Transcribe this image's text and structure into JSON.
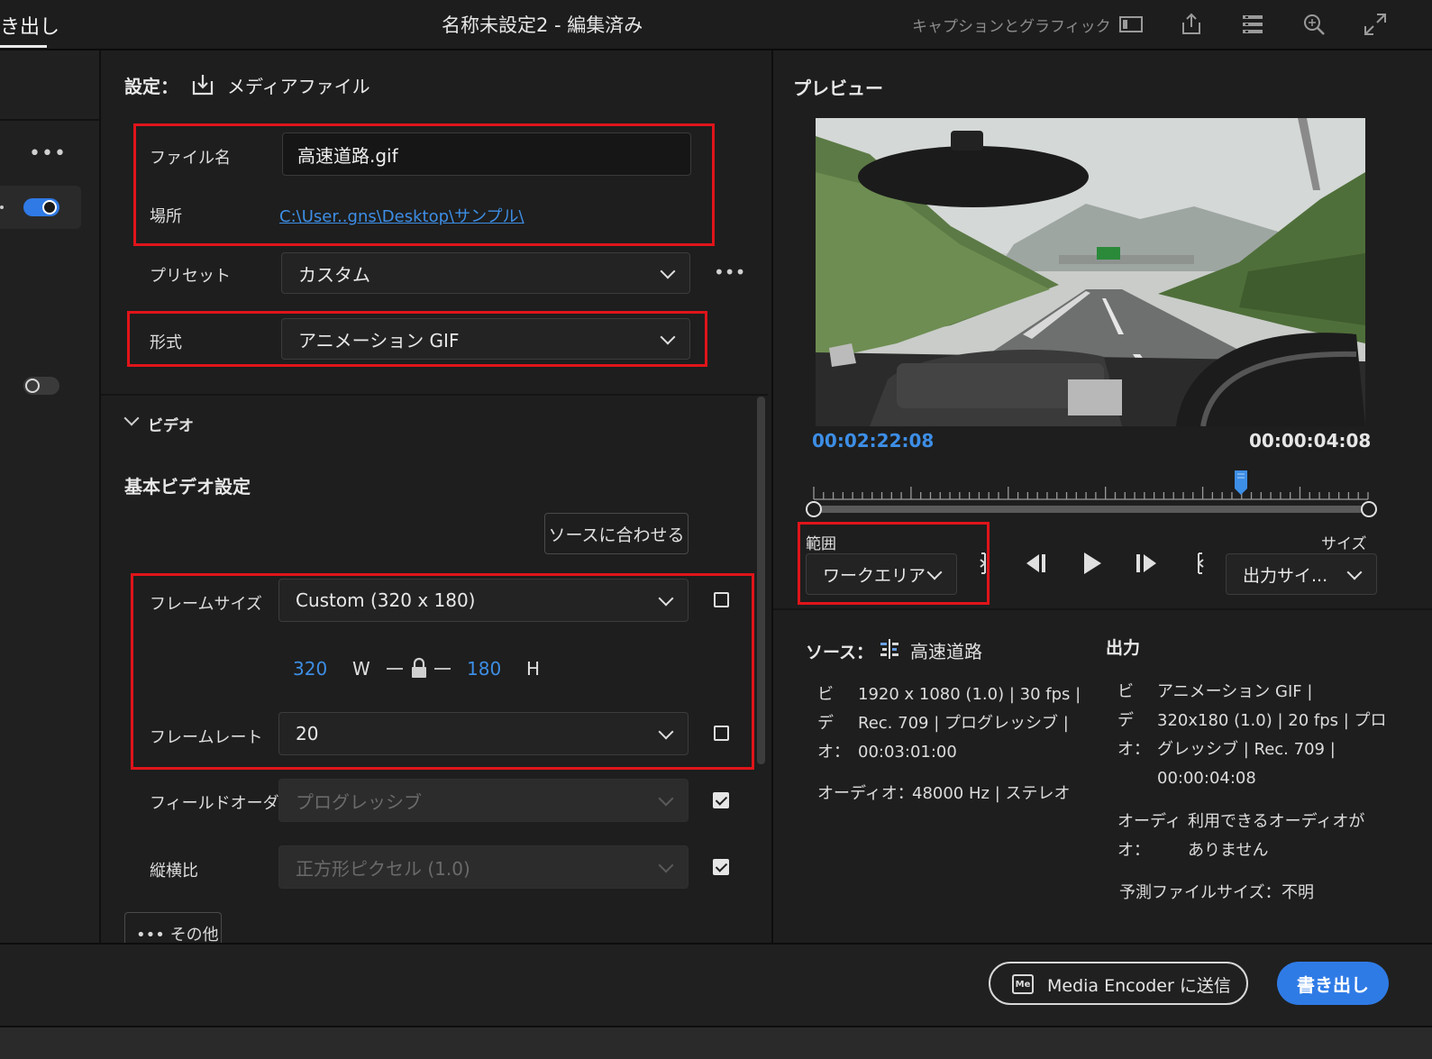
{
  "topbar": {
    "tab_export": "き出し",
    "doc_title": "名称未設定2 - 編集済み",
    "captions_graphics": "キャプションとグラフィック",
    "icons": [
      "panel-icon",
      "share-icon",
      "queue-list-icon",
      "search-zoom-icon",
      "expand-icon"
    ]
  },
  "left": {
    "more_label": "•••"
  },
  "settings": {
    "header_prefix": "設定：",
    "header_title": "メディアファイル",
    "filename_label": "ファイル名",
    "filename_value": "高速道路.gif",
    "location_label": "場所",
    "location_value": "C:\\User..gns\\Desktop\\サンプル\\",
    "preset_label": "プリセット",
    "preset_value": "カスタム",
    "preset_more": "•••",
    "format_label": "形式",
    "format_value": "アニメーション GIF",
    "video_section": "ビデオ",
    "basic_video": "基本ビデオ設定",
    "match_source": "ソースに合わせる",
    "frame_size_label": "フレームサイズ",
    "frame_size_value": "Custom (320 x 180)",
    "width_value": "320",
    "width_unit": "W",
    "height_value": "180",
    "height_unit": "H",
    "frame_rate_label": "フレームレート",
    "frame_rate_value": "20",
    "field_order_label": "フィールドオーダー",
    "field_order_value": "プログレッシブ",
    "aspect_label": "縦横比",
    "aspect_value": "正方形ピクセル (1.0)",
    "more_label": "••• その他"
  },
  "preview": {
    "title": "プレビュー",
    "time_current": "00:02:22:08",
    "time_duration": "00:00:04:08",
    "playhead_fraction": 0.77,
    "range_label": "範囲",
    "range_value": "ワークエリア",
    "size_label": "サイズ",
    "size_value": "出力サイ...",
    "source_label": "ソース：",
    "source_name": "高速道路",
    "source_video_lines": [
      "1920 x 1080 (1.0) | 30 fps |",
      "Rec. 709 | プログレッシブ |",
      "00:03:01:00"
    ],
    "video_label_chars": [
      "ビ",
      "デ",
      "オ："
    ],
    "source_audio_label": "オーディオ：",
    "source_audio_value": "48000 Hz | ステレオ",
    "output_label": "出力",
    "output_video_lines": [
      "アニメーション GIF |",
      "320x180 (1.0) | 20 fps | プロ",
      "グレッシブ | Rec. 709 |",
      "00:00:04:08"
    ],
    "output_audio_label_1": "オーディ",
    "output_audio_label_2": "オ：",
    "output_audio_value_1": "利用できるオーディオが",
    "output_audio_value_2": "ありません",
    "filesize_label": "予測ファイルサイズ：",
    "filesize_value": "不明"
  },
  "bottom": {
    "me_badge": "Me",
    "send_me": "Media Encoder に送信",
    "export": "書き出し"
  },
  "colors": {
    "accent": "#2f7be6",
    "highlight_box": "#e0141a",
    "link": "#3d8ee6"
  }
}
